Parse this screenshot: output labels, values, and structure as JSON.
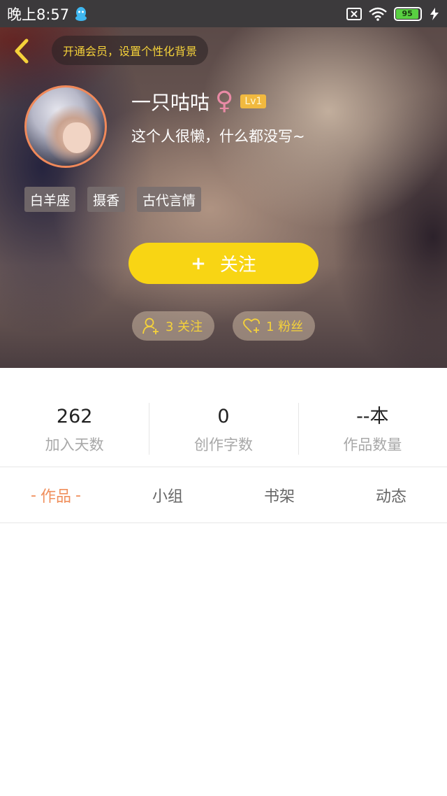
{
  "status_bar": {
    "time": "晚上8:57",
    "battery_level": "95",
    "icons": [
      "qq-icon",
      "sim-off-icon",
      "wifi-icon",
      "battery-icon",
      "charging-icon"
    ]
  },
  "header": {
    "vip_banner": "开通会员，设置个性化背景"
  },
  "profile": {
    "nickname": "一只咕咕",
    "gender_symbol": "♀",
    "level": "Lv1",
    "bio": "这个人很懒，什么都没写~",
    "tags": [
      "白羊座",
      "摄香",
      "古代言情"
    ],
    "follow_button": {
      "plus": "+",
      "label": "关注"
    },
    "following": "3 关注",
    "fans": "1 粉丝"
  },
  "stats": [
    {
      "value": "262",
      "label": "加入天数"
    },
    {
      "value": "0",
      "label": "创作字数"
    },
    {
      "value": "--本",
      "label": "作品数量"
    }
  ],
  "tabs": [
    {
      "label": "作品",
      "active": true
    },
    {
      "label": "小组",
      "active": false
    },
    {
      "label": "书架",
      "active": false
    },
    {
      "label": "动态",
      "active": false
    }
  ],
  "tab_active_prefix": "-",
  "tab_active_suffix": "-",
  "colors": {
    "accent": "#f8d514",
    "gold_text": "#f5d23a",
    "active_tab": "#f08f5c",
    "avatar_ring": "#f0895a",
    "female": "#e98aa5"
  }
}
